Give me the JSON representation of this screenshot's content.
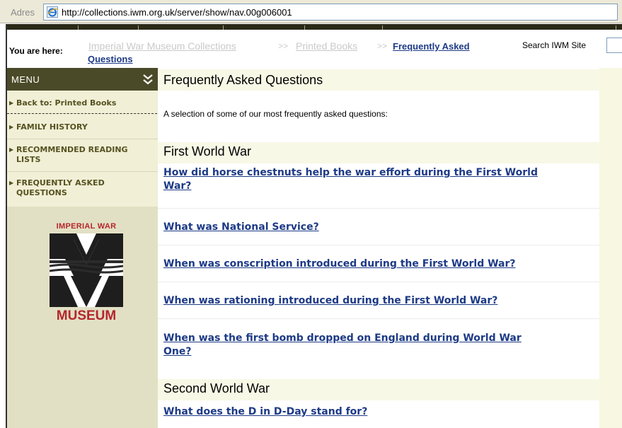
{
  "address_bar": {
    "label": "Adres",
    "url": "http://collections.iwm.org.uk/server/show/nav.00g006001"
  },
  "breadcrumb": {
    "prefix": "You are here:",
    "items": [
      "Imperial War Museum Collections",
      "Printed Books",
      "Frequently Asked",
      "Questions"
    ],
    "separator": ">>"
  },
  "search": {
    "label": "Search IWM Site",
    "value": ""
  },
  "menu": {
    "title": "MENU",
    "items": [
      {
        "label": "Back to: Printed Books"
      },
      {
        "label": "FAMILY HISTORY"
      },
      {
        "label": "RECOMMENDED READING",
        "label2": "LISTS"
      },
      {
        "label": "FREQUENTLY ASKED",
        "label2": "QUESTIONS"
      }
    ]
  },
  "logo": {
    "top_text": "IMPERIAL WAR",
    "bottom_text": "MUSEUM"
  },
  "main": {
    "title": "Frequently Asked Questions",
    "intro": "A selection of some of our most frequently asked questions:",
    "sections": [
      {
        "title": "First World War",
        "questions": [
          {
            "line1": "How did horse chestnuts help the war effort during the First World",
            "line2": "War?"
          },
          {
            "line1": "What was National Service?"
          },
          {
            "line1": "When was conscription introduced during the First World War?"
          },
          {
            "line1": "When was rationing introduced during the First World War?"
          },
          {
            "line1": "When was the first bomb dropped on England during World War",
            "line2": "One?"
          }
        ]
      },
      {
        "title": "Second World War",
        "questions": [
          {
            "line1": "What does the D in D-Day stand for?"
          }
        ]
      }
    ]
  },
  "colors": {
    "menu_header": "#4a4a28",
    "menu_panel": "#f1efd6",
    "logo_panel": "#e2e0c4",
    "link": "#1d3a86",
    "logo_red": "#b5262c"
  }
}
